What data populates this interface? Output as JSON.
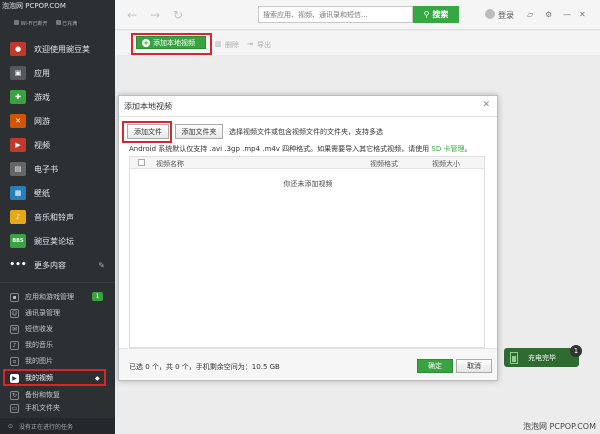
{
  "watermark_top": "泡泡网 PCPOP.COM",
  "watermark_bottom": "泡泡网 PCPOP.COM",
  "user": {
    "line1": "Wi-Fi已断开",
    "line2": "已充满"
  },
  "nav": [
    {
      "label": "欢迎使用豌豆荚",
      "icon": "pea-icon",
      "color": "#c0392b"
    },
    {
      "label": "应用",
      "icon": "bag-icon",
      "color": "#3b3f42"
    },
    {
      "label": "游戏",
      "icon": "gamepad-icon",
      "color": "#3aa341"
    },
    {
      "label": "网游",
      "icon": "swords-icon",
      "color": "#d35400"
    },
    {
      "label": "视频",
      "icon": "video-icon",
      "color": "#c0392b"
    },
    {
      "label": "电子书",
      "icon": "book-icon",
      "color": "#555"
    },
    {
      "label": "壁纸",
      "icon": "image-icon",
      "color": "#2980b9"
    },
    {
      "label": "音乐和铃声",
      "icon": "music-icon",
      "color": "#e6a817"
    },
    {
      "label": "豌豆荚论坛",
      "icon": "bbs-icon",
      "color": "#3aa341",
      "icon_text": "BBS"
    },
    {
      "label": "更多内容",
      "icon": "more-icon",
      "color": "#2c3032",
      "icon_text": "•••"
    }
  ],
  "sub_nav": [
    {
      "label": "应用和游戏管理",
      "badge": "1"
    },
    {
      "label": "通讯录管理"
    },
    {
      "label": "短信收发"
    },
    {
      "label": "我的音乐"
    },
    {
      "label": "我的图片"
    },
    {
      "label": "我的视频"
    },
    {
      "label": "备份和恢复"
    },
    {
      "label": "手机文件夹"
    }
  ],
  "bottom_task": "没有正在进行的任务",
  "toolbar": {
    "search_placeholder": "搜索应用、视频、通讯录和短信...",
    "search_button": "搜索",
    "login": "登录"
  },
  "actionbar": {
    "add_local": "添加本地视频",
    "delete": "删除",
    "export": "导出"
  },
  "dialog": {
    "title": "添加本地视频",
    "add_file": "添加文件",
    "add_folder": "添加文件夹",
    "hint": "选择视频文件或包含视频文件的文件夹，支持多选",
    "android_note": "Android 系统默认仅支持 .avi .3gp .mp4 .m4v 四种格式。如果需要导入其它格式视频，请使用",
    "sd_link": "SD 卡管理",
    "android_note_end": "。",
    "columns": [
      "视频名称",
      "视频格式",
      "视频大小"
    ],
    "empty": "你还未添加视频",
    "status": "已选 0 个，共 0 个，手机剩余空间为：10.5 GB",
    "ok": "确定",
    "cancel": "取消"
  },
  "charging": {
    "label": "充电完毕",
    "badge": "1"
  }
}
